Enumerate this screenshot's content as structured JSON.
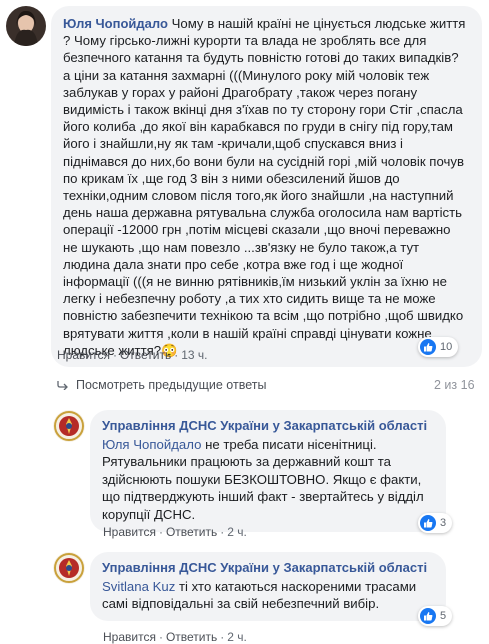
{
  "comments": [
    {
      "author": "Юля Чопойдало",
      "text": "Чому в нашій країні не цінується людське життя ? Чому гірсько-лижні курорти та влада не зроблять все для безпечного катання та будуть повністю готові до таких випадків? а ціни за катання захмарні (((Минулого року мій чоловік теж заблукав у горах у районі Драгобрату ,також через погану видимість і також вкінці дня з'їхав по ту сторону гори Стіг ,спасла його колиба ,до якої він карабкався по груди в снігу під гору,там його і знайшли,ну як там -кричали,щоб спускався вниз і піднімався до них,бо вони були на сусідній горі ,мій чоловік почув по крикам їх ,ще год 3 він з ними обезсилений йшов до техніки,одним словом після того,як його знайшли ,на наступний день наша державна рятувальна служба оголосила нам вартість операції -12000 грн ,потім місцеві сказали ,що вночі переважно не шукають ,що нам повезло ...зв'язку не було також,а тут людина дала знати про себе ,котра вже год і ще жодної інформації (((я не винню рятівників,їм низький уклін за їхню не легку і небезпечну роботу ,а тих хто сидить вище та не може повністю забезпечити технікою та всім ,що потрібно ,щоб швидко врятувати життя ,коли в нашій країні справді цінувати кожне людське життя?😳",
      "like": "Нравится",
      "reply": "Ответить",
      "time": "13 ч.",
      "reaction_count": "10"
    }
  ],
  "previous": {
    "label": "Посмотреть предыдущие ответы",
    "counter": "2 из 16"
  },
  "replies": [
    {
      "author": "Управління ДСНС України у Закарпатській області",
      "mention": "Юля Чопойдало",
      "text": " не треба писати нісенітниці. Рятувальники працюють за державний кошт та здійснюють пошуки БЕЗКОШТОВНО. Якщо є факти, що підтверджують інший факт - звертайтесь у відділ корупції ДСНС.",
      "like": "Нравится",
      "reply": "Ответить",
      "time": "2 ч.",
      "reaction_count": "3"
    },
    {
      "author": "Управління ДСНС України у Закарпатській області",
      "mention": "Svitlana Kuz",
      "text": " ті хто катаються наскореними трасами самі відповідальні за свій небезпечний вибір.",
      "like": "Нравится",
      "reply": "Ответить",
      "time": "2 ч.",
      "reaction_count": "5"
    }
  ],
  "colors": {
    "link": "#385898",
    "bubble": "#f2f3f5",
    "like_blue": "#1877f2"
  },
  "icons": {
    "like": "thumbs-up-icon",
    "reply_arrow": "reply-arrow-icon",
    "org_logo": "dsns-emblem-icon"
  }
}
